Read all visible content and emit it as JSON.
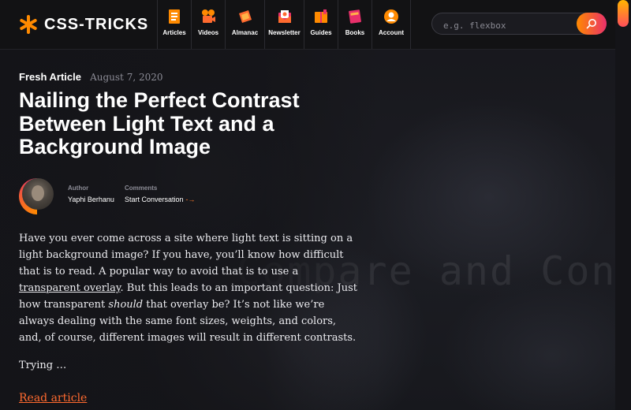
{
  "site": {
    "logo_text": "CSS-TRICKS",
    "accent": "#ff8a00",
    "accent2": "#e9306b"
  },
  "nav": [
    {
      "label": "Articles",
      "icon": "articles-icon"
    },
    {
      "label": "Videos",
      "icon": "videos-icon"
    },
    {
      "label": "Almanac",
      "icon": "almanac-icon"
    },
    {
      "label": "Newsletter",
      "icon": "newsletter-icon"
    },
    {
      "label": "Guides",
      "icon": "guides-icon"
    },
    {
      "label": "Books",
      "icon": "books-icon"
    },
    {
      "label": "Account",
      "icon": "account-icon"
    }
  ],
  "search": {
    "placeholder": "e.g. flexbox"
  },
  "article": {
    "badge": "Fresh Article",
    "date": "August 7, 2020",
    "title": "Nailing the Perfect Contrast Between Light Text and a Background Image",
    "author_label": "Author",
    "author_name": "Yaphi Berhanu",
    "comments_label": "Comments",
    "comments_link": "Start Conversation",
    "body_1": "Have you ever come across a site where light text is sitting on a light background image? If you have, you’ll know how difficult that is to read. A popular way to avoid that is to use a ",
    "body_link": "transparent overlay",
    "body_2": ". But this leads to an important question: Just how transparent ",
    "body_em": "should",
    "body_3": " that overlay be? It’s not like we’re always dealing with the same font sizes, weights, and colors, and, of course, different images will result in different contrasts.",
    "trying": "Trying …",
    "read_more": "Read article"
  },
  "background_text": "Compare and Con"
}
